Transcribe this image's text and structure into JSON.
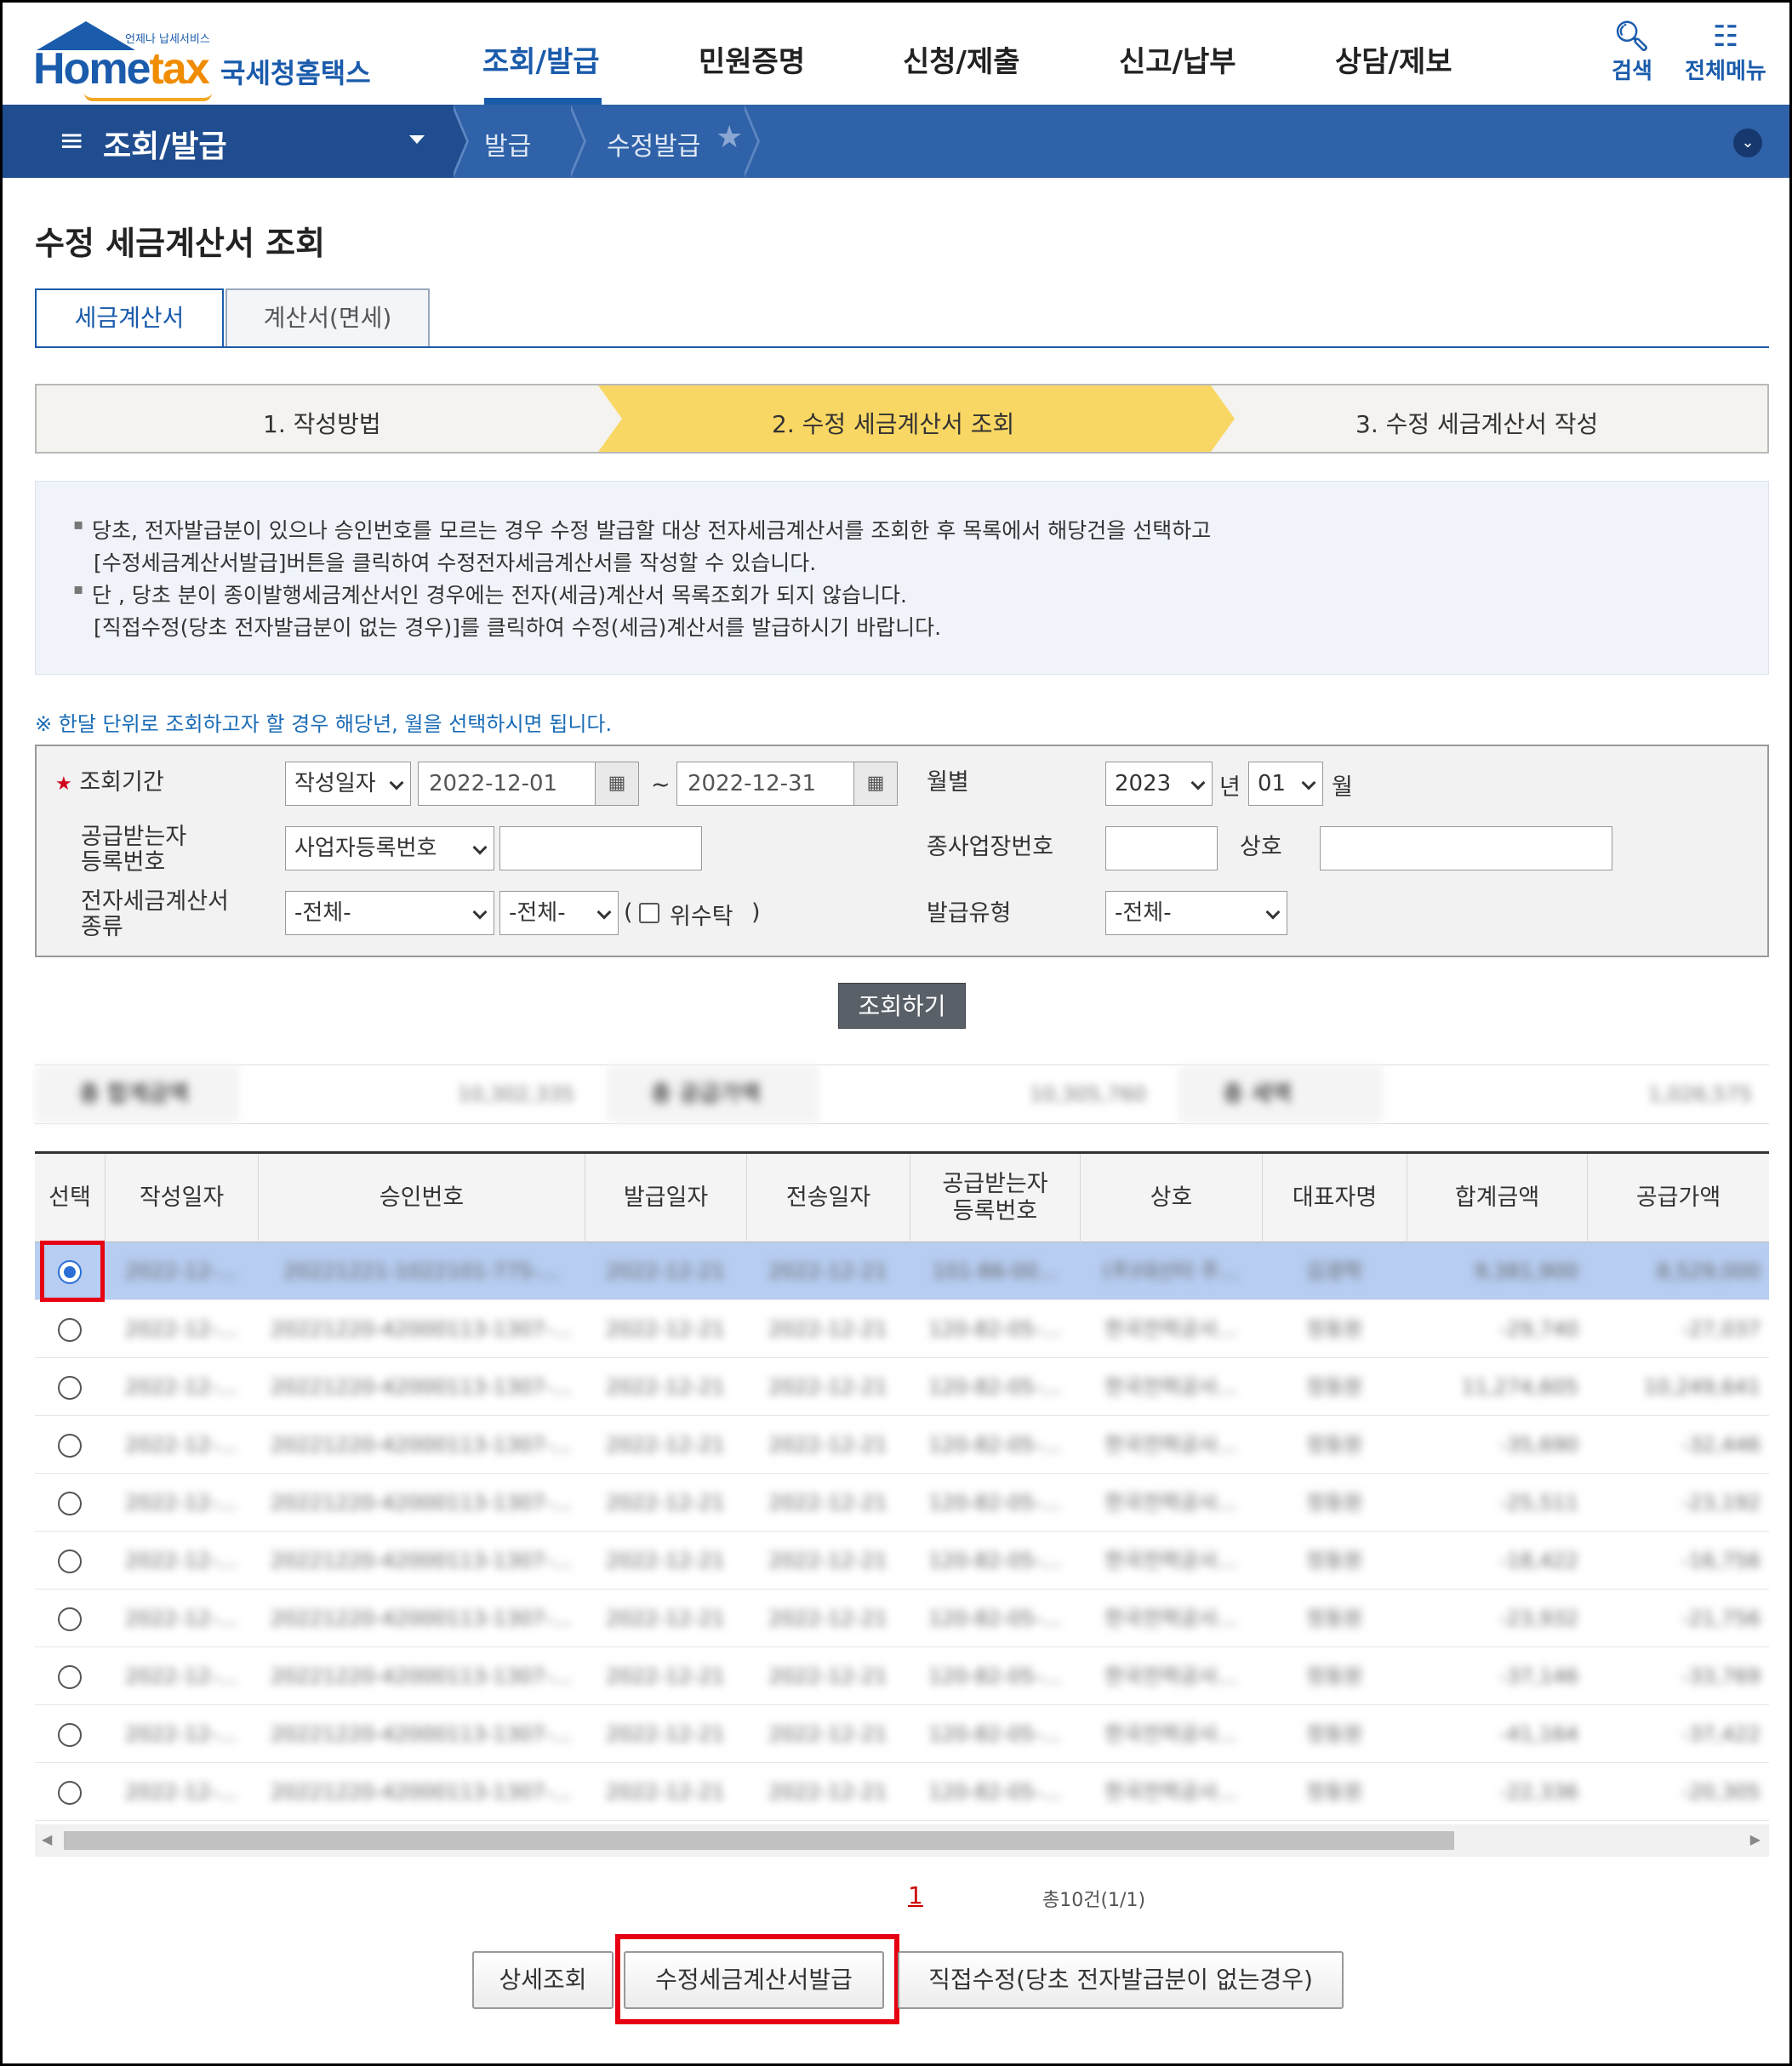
{
  "header": {
    "logo": {
      "tagline": "언제나 납세서비스",
      "word_a": "Home",
      "word_b": "tax",
      "name": "국세청홈택스"
    },
    "gnb": [
      "조회/발급",
      "민원증명",
      "신청/제출",
      "신고/납부",
      "상담/제보"
    ],
    "tools": {
      "search": "검색",
      "all_menu": "전체메뉴"
    }
  },
  "navbar": {
    "section": "조회/발급",
    "crumbs": [
      "발급",
      "수정발급"
    ]
  },
  "page_title": "수정 세금계산서 조회",
  "tabs": [
    "세금계산서",
    "계산서(면세)"
  ],
  "steps": [
    "1. 작성방법",
    "2. 수정 세금계산서 조회",
    "3. 수정 세금계산서 작성"
  ],
  "notice": [
    "당초, 전자발급분이 있으나 승인번호를 모르는 경우 수정 발급할 대상 전자세금계산서를 조회한 후 목록에서 해당건을 선택하고",
    "[수정세금계산서발급]버튼을 클릭하여 수정전자세금계산서를 작성할 수 있습니다.",
    "단 , 당초 분이 종이발행세금계산서인 경우에는 전자(세금)계산서 목록조회가 되지 않습니다.",
    "[직접수정(당초 전자발급분이 없는 경우)]를 클릭하여 수정(세금)계산서를 발급하시기 바랍니다."
  ],
  "hint": "※ 한달 단위로 조회하고자 할 경우 해당년, 월을 선택하시면 됩니다.",
  "form": {
    "period_label": "조회기간",
    "date_type": "작성일자",
    "date_from": "2022-12-01",
    "tilde": "~",
    "date_to": "2022-12-31",
    "month_label": "월별",
    "year": "2023",
    "year_unit": "년",
    "month": "01",
    "month_unit": "월",
    "recv_label_1": "공급받는자",
    "recv_label_2": "등록번호",
    "recv_type": "사업자등록번호",
    "sub_biz_label": "종사업장번호",
    "company_label": "상호",
    "kind_label_1": "전자세금계산서",
    "kind_label_2": "종류",
    "kind_1": "-전체-",
    "kind_2": "-전체-",
    "paren_open": "(",
    "consign_label": "위수탁",
    "paren_close": ")",
    "issue_type_label": "발급유형",
    "issue_type": "-전체-"
  },
  "search_button": "조회하기",
  "summary": [
    {
      "label": "총 합계금액",
      "value": "10,302,335"
    },
    {
      "label": "총 공급가액",
      "value": "10,305,760"
    },
    {
      "label": "총 세액",
      "value": "1,026,575"
    }
  ],
  "table": {
    "headers": [
      "선택",
      "작성일자",
      "승인번호",
      "발급일자",
      "전송일자",
      "공급받는자\n등록번호",
      "상호",
      "대표자명",
      "합계금액",
      "공급가액"
    ],
    "rows": [
      [
        "2022-12-...",
        "20221221-1022101-775-...",
        "2022-12-21",
        "2022-12-21",
        "101-86-00...",
        "(주)대산터 주...",
        "김경학",
        "9,381,900",
        "8,529,000"
      ],
      [
        "2022-12-...",
        "20221220-42000113-1307-...",
        "2022-12-21",
        "2022-12-21",
        "120-82-05-...",
        "한국전력공사...",
        "정동원",
        "-29,740",
        "-27,037"
      ],
      [
        "2022-12-...",
        "20221220-42000113-1307-...",
        "2022-12-21",
        "2022-12-21",
        "120-82-05-...",
        "한국전력공사...",
        "정동원",
        "11,274,605",
        "10,249,641"
      ],
      [
        "2022-12-...",
        "20221220-42000113-1307-...",
        "2022-12-21",
        "2022-12-21",
        "120-82-05-...",
        "한국전력공사...",
        "정동원",
        "-35,690",
        "-32,446"
      ],
      [
        "2022-12-...",
        "20221220-42000113-1307-...",
        "2022-12-21",
        "2022-12-21",
        "120-82-05-...",
        "한국전력공사...",
        "정동원",
        "-25,511",
        "-23,192"
      ],
      [
        "2022-12-...",
        "20221220-42000113-1307-...",
        "2022-12-21",
        "2022-12-21",
        "120-82-05-...",
        "한국전력공사...",
        "정동원",
        "-18,422",
        "-16,756"
      ],
      [
        "2022-12-...",
        "20221220-42000113-1307-...",
        "2022-12-21",
        "2022-12-21",
        "120-82-05-...",
        "한국전력공사...",
        "정동원",
        "-23,932",
        "-21,756"
      ],
      [
        "2022-12-...",
        "20221220-42000113-1307-...",
        "2022-12-21",
        "2022-12-21",
        "120-82-05-...",
        "한국전력공사...",
        "정동원",
        "-37,146",
        "-33,769"
      ],
      [
        "2022-12-...",
        "20221220-42000113-1307-...",
        "2022-12-21",
        "2022-12-21",
        "120-82-05-...",
        "한국전력공사...",
        "정동원",
        "-41,164",
        "-37,422"
      ],
      [
        "2022-12-...",
        "20221220-42000113-1307-...",
        "2022-12-21",
        "2022-12-21",
        "120-82-05-...",
        "한국전력공사...",
        "정동원",
        "-22,336",
        "-20,305"
      ]
    ],
    "selected_row": 0
  },
  "paging": {
    "current": "1",
    "total": "총10건(1/1)"
  },
  "buttons": {
    "detail": "상세조회",
    "issue": "수정세금계산서발급",
    "direct": "직접수정(당초 전자발급분이 없는경우)"
  },
  "colors": {
    "brand": "#1a5bab",
    "highlight": "#e60012",
    "step_active": "#f9d764"
  }
}
